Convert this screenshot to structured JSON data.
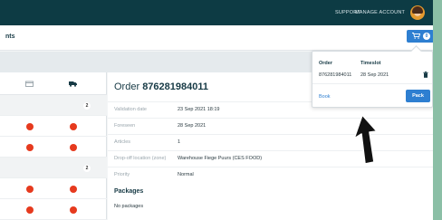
{
  "topbar": {
    "support_label": "SUPPORT",
    "manage_account_label": "MANAGE ACCOUNT"
  },
  "header": {
    "title_partial": "nts",
    "cart_count": "0"
  },
  "left_table": {
    "group_rows": [
      {
        "count": "2"
      },
      {
        "count": "2"
      }
    ]
  },
  "order": {
    "title_prefix": "Order ",
    "number": "876281984011",
    "fields": [
      {
        "label": "Validation date",
        "value": "23 Sep 2021 18:19"
      },
      {
        "label": "Foreseen",
        "value": "28 Sep 2021"
      },
      {
        "label": "Articles",
        "value": "1"
      },
      {
        "label": "Drop-off location (zone)",
        "value": "Warehouse Fiege Puurs (CES FOOD)"
      },
      {
        "label": "Priority",
        "value": "Normal"
      }
    ],
    "packages_title": "Packages",
    "packages_empty": "No packages"
  },
  "popover": {
    "col_order": "Order",
    "col_timeslot": "Timeslot",
    "row": {
      "order": "876281984011",
      "timeslot": "28 Sep 2021"
    },
    "book_label": "Book",
    "pack_label": "Pack"
  },
  "colors": {
    "topbar": "#0d3b44",
    "accent": "#2e7fd1",
    "status_dot": "#e63a1e",
    "background": "#8bbfa6"
  }
}
